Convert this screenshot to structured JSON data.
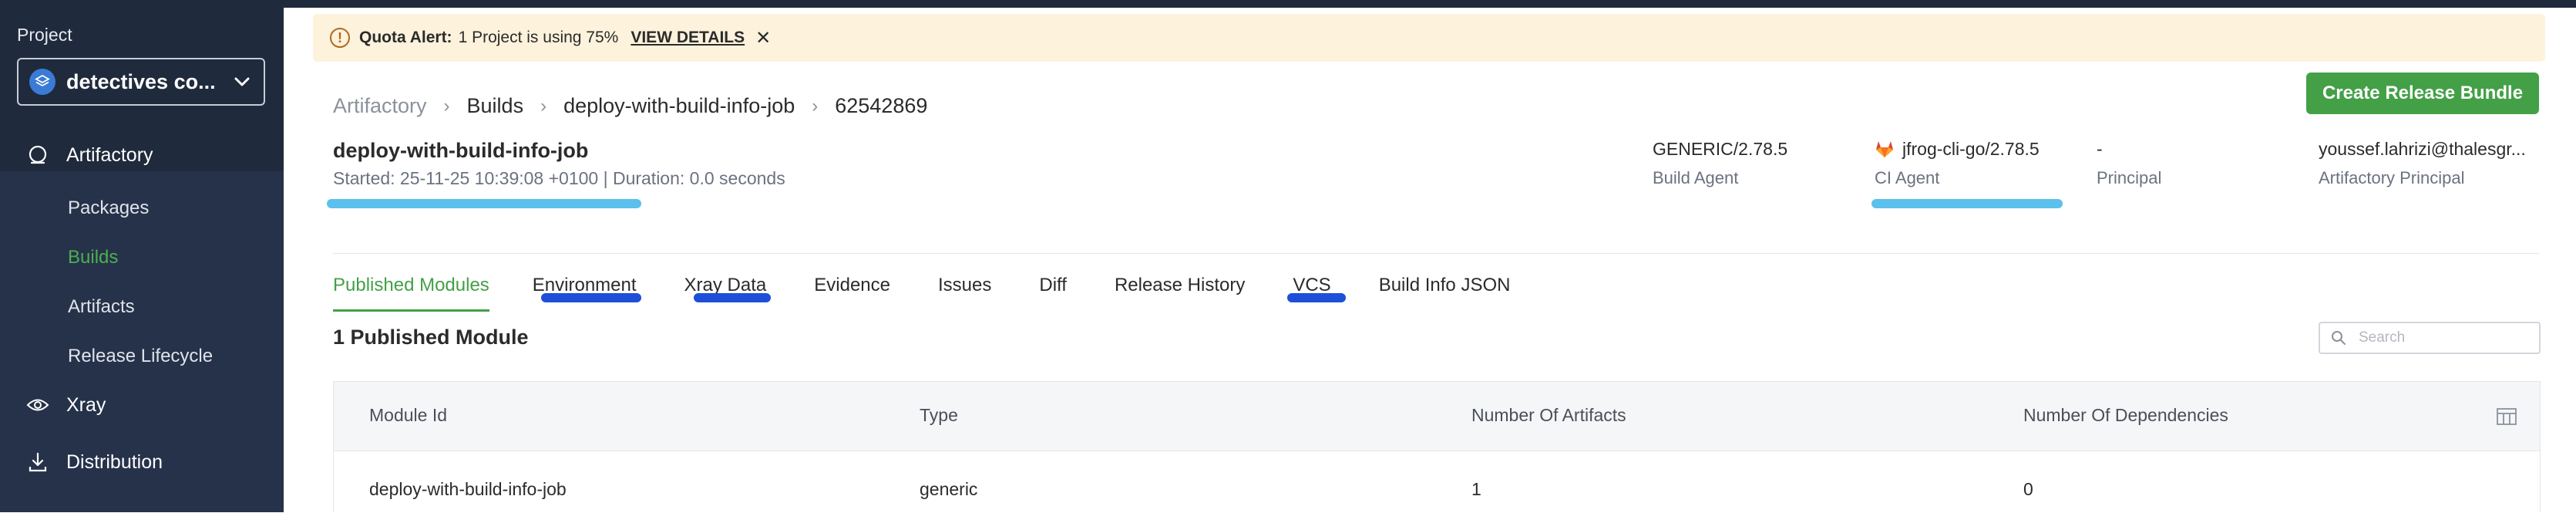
{
  "sidebar": {
    "project_label": "Project",
    "project_name": "detectives co...",
    "sections": {
      "artifactory": "Artifactory",
      "xray": "Xray",
      "distribution": "Distribution"
    },
    "items": [
      {
        "label": "Packages"
      },
      {
        "label": "Builds"
      },
      {
        "label": "Artifacts"
      },
      {
        "label": "Release Lifecycle"
      }
    ]
  },
  "quota": {
    "title": "Quota Alert:",
    "message": "1 Project is using 75%",
    "link": "VIEW DETAILS"
  },
  "breadcrumb": [
    "Artifactory",
    "Builds",
    "deploy-with-build-info-job",
    "62542869"
  ],
  "actions": {
    "create_release_bundle": "Create Release Bundle"
  },
  "build": {
    "name": "deploy-with-build-info-job",
    "meta": "Started: 25-11-25 10:39:08 +0100 | Duration: 0.0 seconds"
  },
  "info": [
    {
      "value": "GENERIC/2.78.5",
      "label": "Build Agent"
    },
    {
      "value": "jfrog-cli-go/2.78.5",
      "label": "CI Agent",
      "icon": "gitlab-icon"
    },
    {
      "value": "-",
      "label": "Principal"
    },
    {
      "value": "youssef.lahrizi@thalesgr...",
      "label": "Artifactory Principal"
    }
  ],
  "tabs": [
    {
      "label": "Published Modules",
      "active": true
    },
    {
      "label": "Environment"
    },
    {
      "label": "Xray Data"
    },
    {
      "label": "Evidence"
    },
    {
      "label": "Issues"
    },
    {
      "label": "Diff"
    },
    {
      "label": "Release History"
    },
    {
      "label": "VCS"
    },
    {
      "label": "Build Info JSON"
    }
  ],
  "modules": {
    "title": "1 Published Module",
    "search_placeholder": "Search",
    "columns": [
      "Module Id",
      "Type",
      "Number Of Artifacts",
      "Number Of Dependencies"
    ],
    "rows": [
      [
        "deploy-with-build-info-job",
        "generic",
        "1",
        "0"
      ]
    ]
  },
  "colors": {
    "sidebar_bg": "#1f2a3c",
    "accent_green": "#43a047",
    "quota_bg": "#fdf2dc",
    "annotation_light_blue": "#5bc0eb",
    "annotation_dark_blue": "#1e4fd8"
  }
}
